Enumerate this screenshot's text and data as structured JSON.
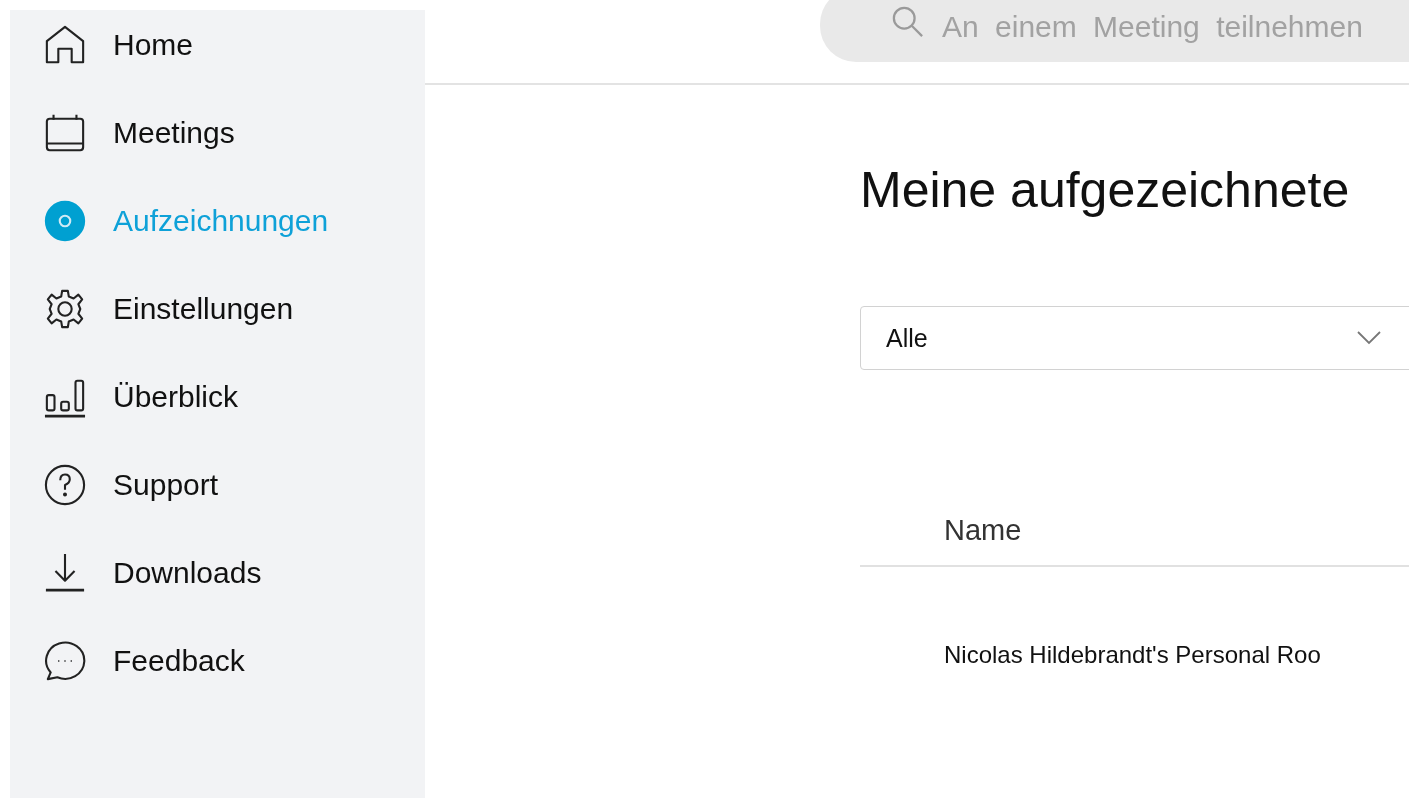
{
  "sidebar": {
    "items": [
      {
        "label": "Home",
        "selected": false
      },
      {
        "label": "Meetings",
        "selected": false
      },
      {
        "label": "Aufzeichnungen",
        "selected": true
      },
      {
        "label": "Einstellungen",
        "selected": false
      },
      {
        "label": "Überblick",
        "selected": false
      },
      {
        "label": "Support",
        "selected": false
      },
      {
        "label": "Downloads",
        "selected": false
      },
      {
        "label": "Feedback",
        "selected": false
      }
    ]
  },
  "search": {
    "placeholder": "An einem Meeting teilnehmen"
  },
  "page_title": "Meine aufgezeichnete",
  "filter": {
    "value": "Alle"
  },
  "table": {
    "columns": [
      "Name"
    ],
    "rows": [
      [
        "Nicolas Hildebrandt's Personal Roo"
      ]
    ]
  }
}
